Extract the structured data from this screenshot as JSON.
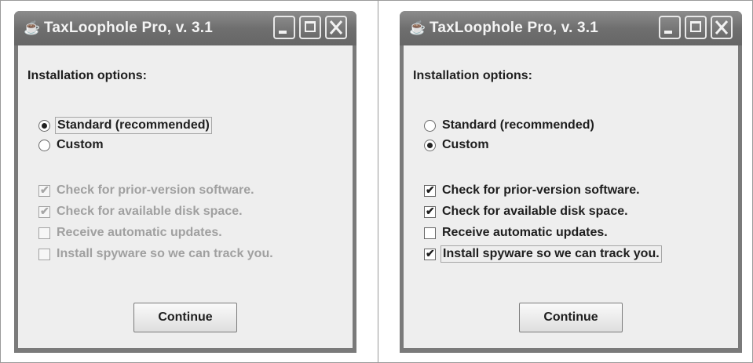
{
  "windows": [
    {
      "title": "TaxLoophole Pro, v. 3.1",
      "heading": "Installation options:",
      "radios": [
        {
          "label": "Standard (recommended)",
          "selected": true
        },
        {
          "label": "Custom",
          "selected": false
        }
      ],
      "checks_enabled": false,
      "checks": [
        {
          "label": "Check for prior-version software.",
          "checked": true
        },
        {
          "label": "Check for available disk space.",
          "checked": true
        },
        {
          "label": "Receive automatic updates.",
          "checked": false
        },
        {
          "label": "Install spyware so we can track you.",
          "checked": false
        }
      ],
      "continue_label": "Continue"
    },
    {
      "title": "TaxLoophole Pro, v. 3.1",
      "heading": "Installation options:",
      "radios": [
        {
          "label": "Standard (recommended)",
          "selected": false
        },
        {
          "label": "Custom",
          "selected": true
        }
      ],
      "checks_enabled": true,
      "checks": [
        {
          "label": "Check for prior-version software.",
          "checked": true
        },
        {
          "label": "Check for available disk space.",
          "checked": true
        },
        {
          "label": "Receive automatic updates.",
          "checked": false
        },
        {
          "label": "Install spyware so we can track you.",
          "checked": true
        }
      ],
      "continue_label": "Continue"
    }
  ],
  "icons": {
    "app": "java-coffee-cup-icon",
    "minimize": "minimize-icon",
    "maximize": "maximize-icon",
    "close": "close-icon",
    "check": "check-icon"
  }
}
